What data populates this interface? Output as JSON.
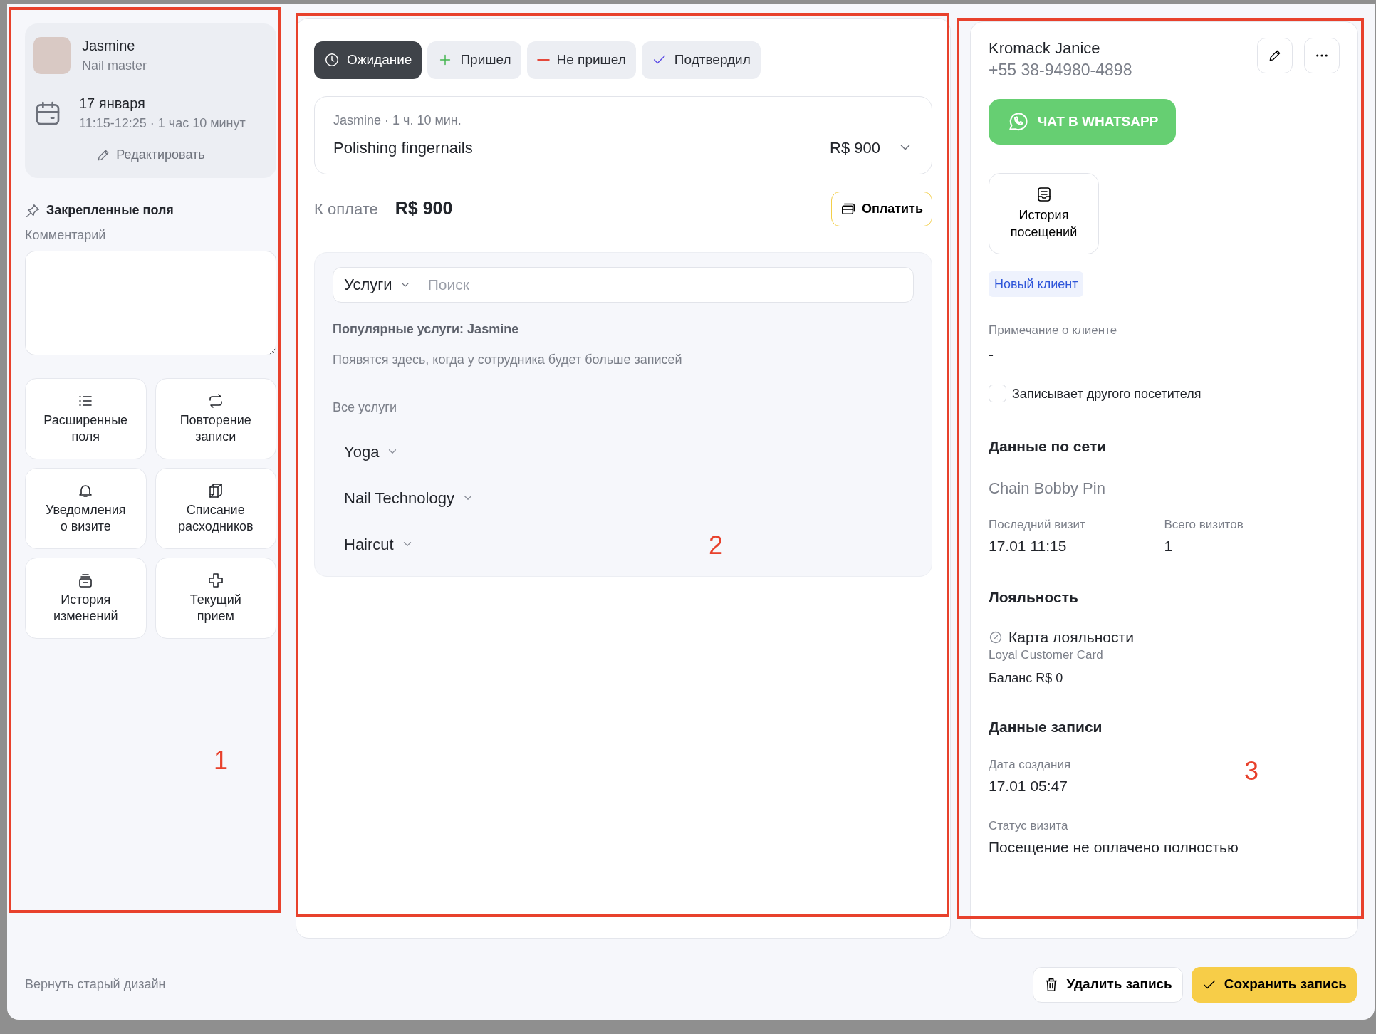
{
  "staff": {
    "name": "Jasmine",
    "role": "Nail master"
  },
  "appointment": {
    "date": "17 января",
    "time": "11:15-12:25 · 1 час 10 минут",
    "edit": "Редактировать"
  },
  "pinned": {
    "title": "Закрепленные поля",
    "comment_label": "Комментарий"
  },
  "actions": [
    {
      "label": "Расширенные поля"
    },
    {
      "label": "Повторение записи"
    },
    {
      "label": "Уведомления о визите"
    },
    {
      "label": "Списание расходников"
    },
    {
      "label": "История изменений"
    },
    {
      "label": "Текущий прием"
    }
  ],
  "statuses": [
    {
      "label": "Ожидание",
      "selected": true
    },
    {
      "label": "Пришел",
      "selected": false
    },
    {
      "label": "Не пришел",
      "selected": false
    },
    {
      "label": "Подтвердил",
      "selected": false
    }
  ],
  "service": {
    "meta": "Jasmine · 1 ч. 10 мин.",
    "name": "Polishing fingernails",
    "price": "R$ 900"
  },
  "payment": {
    "label": "К оплате",
    "amount": "R$ 900",
    "button": "Оплатить"
  },
  "catalog": {
    "dropdown": "Услуги",
    "placeholder": "Поиск",
    "popular_title": "Популярные услуги: Jasmine",
    "popular_hint": "Появятся здесь, когда у сотрудника будет больше записей",
    "all_title": "Все услуги",
    "categories": [
      "Yoga",
      "Nail Technology",
      "Haircut"
    ]
  },
  "client": {
    "name": "Kromack Janice",
    "phone": "+55 38-94980-4898",
    "whatsapp": "ЧАТ В WHATSAPP",
    "history": "История посещений",
    "tag": "Новый клиент",
    "note_label": "Примечание о клиенте",
    "note": "-",
    "other_visitor": {
      "label": "Записывает другого посетителя",
      "checked": false
    }
  },
  "network": {
    "title": "Данные по сети",
    "chain": "Chain Bobby Pin",
    "stats": [
      {
        "label": "Последний визит",
        "value": "17.01 11:15"
      },
      {
        "label": "Всего визитов",
        "value": "1"
      }
    ]
  },
  "loyalty": {
    "title": "Лояльность",
    "card": "Карта лояльности",
    "card_name": "Loyal Customer Card",
    "balance": "Баланс R$ 0"
  },
  "record": {
    "title": "Данные записи",
    "fields": [
      {
        "label": "Дата создания",
        "value": "17.01 05:47"
      },
      {
        "label": "Статус визита",
        "value": "Посещение не оплачено полностью"
      }
    ]
  },
  "footer": {
    "old_design": "Вернуть старый дизайн",
    "delete": "Удалить запись",
    "save": "Сохранить запись"
  },
  "annotations": [
    "1",
    "2",
    "3"
  ]
}
